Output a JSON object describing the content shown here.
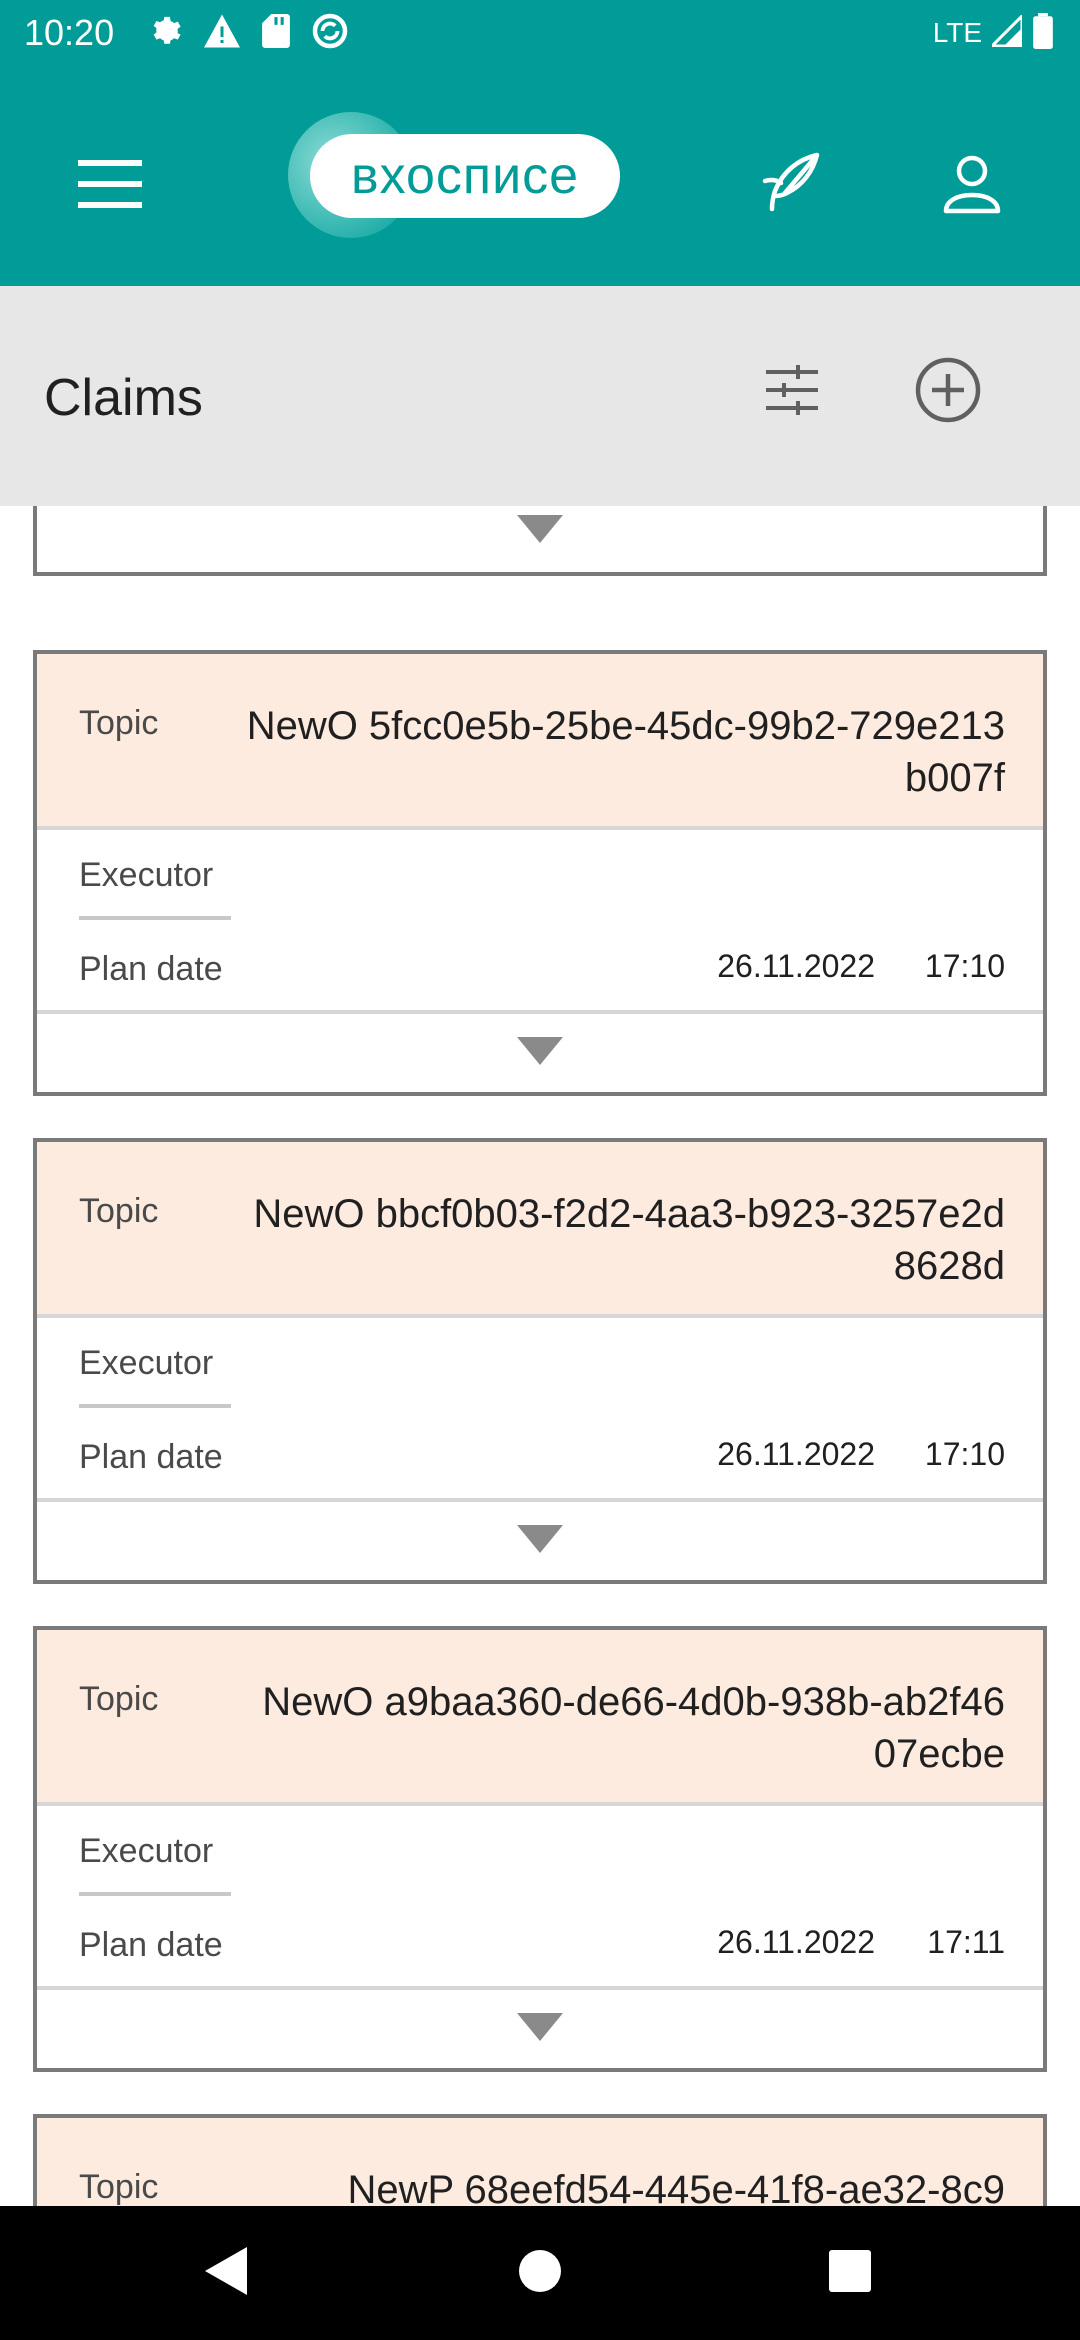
{
  "status_bar": {
    "time": "10:20",
    "network": "LTE",
    "icons": [
      "settings-icon",
      "warning-icon",
      "sd-card-icon",
      "vpn-icon",
      "signal-icon",
      "battery-icon"
    ]
  },
  "app_bar": {
    "logo_text": "вхосписе",
    "icons": [
      "menu-icon",
      "feather-icon",
      "profile-icon"
    ],
    "colors": {
      "primary": "#019c98"
    }
  },
  "title_bar": {
    "title": "Claims",
    "icons": [
      "filter-icon",
      "add-circle-icon"
    ]
  },
  "claims": [
    {
      "topic_label": "Topic",
      "topic": "NewO 5fcc0e5b-25be-45dc-99b2-729e213b007f",
      "executor_label": "Executor",
      "executor": "",
      "plan_date_label": "Plan date",
      "plan_date": "26.11.2022",
      "plan_time": "17:10"
    },
    {
      "topic_label": "Topic",
      "topic": "NewO bbcf0b03-f2d2-4aa3-b923-3257e2d8628d",
      "executor_label": "Executor",
      "executor": "",
      "plan_date_label": "Plan date",
      "plan_date": "26.11.2022",
      "plan_time": "17:10"
    },
    {
      "topic_label": "Topic",
      "topic": "NewO a9baa360-de66-4d0b-938b-ab2f4607ecbe",
      "executor_label": "Executor",
      "executor": "",
      "plan_date_label": "Plan date",
      "plan_date": "26.11.2022",
      "plan_time": "17:11"
    },
    {
      "topic_label": "Topic",
      "topic": "NewP 68eefd54-445e-41f8-ae32-8c9"
    }
  ],
  "nav_bar": {
    "icons": [
      "back-icon",
      "home-icon",
      "recents-icon"
    ]
  }
}
